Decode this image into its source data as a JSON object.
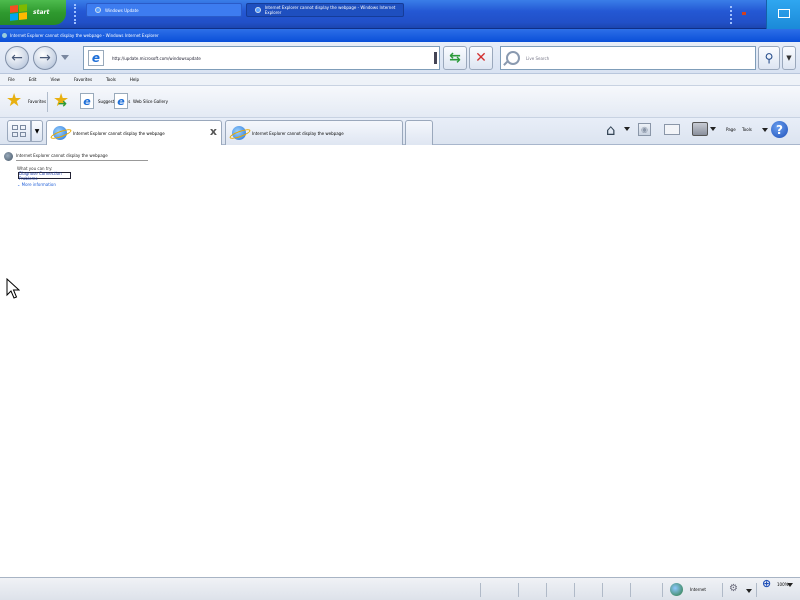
{
  "taskbar": {
    "start_label": "start",
    "tasks": [
      {
        "label": "Windows Update"
      },
      {
        "label": "Internet Explorer cannot display the webpage - Windows Internet Explorer"
      }
    ]
  },
  "window": {
    "title": "Internet Explorer cannot display the webpage - Windows Internet Explorer"
  },
  "address_bar": {
    "url": "http://update.microsoft.com/windowsupdate"
  },
  "search": {
    "placeholder": "Live Search"
  },
  "menu": [
    "File",
    "Edit",
    "View",
    "Favorites",
    "Tools",
    "Help"
  ],
  "favorites_bar": {
    "favorites_label": "Favorites",
    "links": [
      {
        "label": "Suggested Sites"
      },
      {
        "label": "Web Slice Gallery"
      }
    ]
  },
  "tabs": [
    {
      "label": "Internet Explorer cannot display the webpage"
    },
    {
      "label": "Internet Explorer cannot display the webpage"
    }
  ],
  "command_bar": {
    "page_label": "Page",
    "tools_label": "Tools"
  },
  "content": {
    "error_title": "Internet Explorer cannot display the webpage",
    "try_text": "What you can try:",
    "diagnose_label": "Diagnose Connection Problems",
    "more_info": "More information"
  },
  "status_bar": {
    "zone": "Internet",
    "zoom": "100%"
  },
  "colors": {
    "taskbar": "#2458d4",
    "start": "#2f9a2f",
    "titlebar": "#0a4fd8",
    "link": "#1e5ed8"
  }
}
